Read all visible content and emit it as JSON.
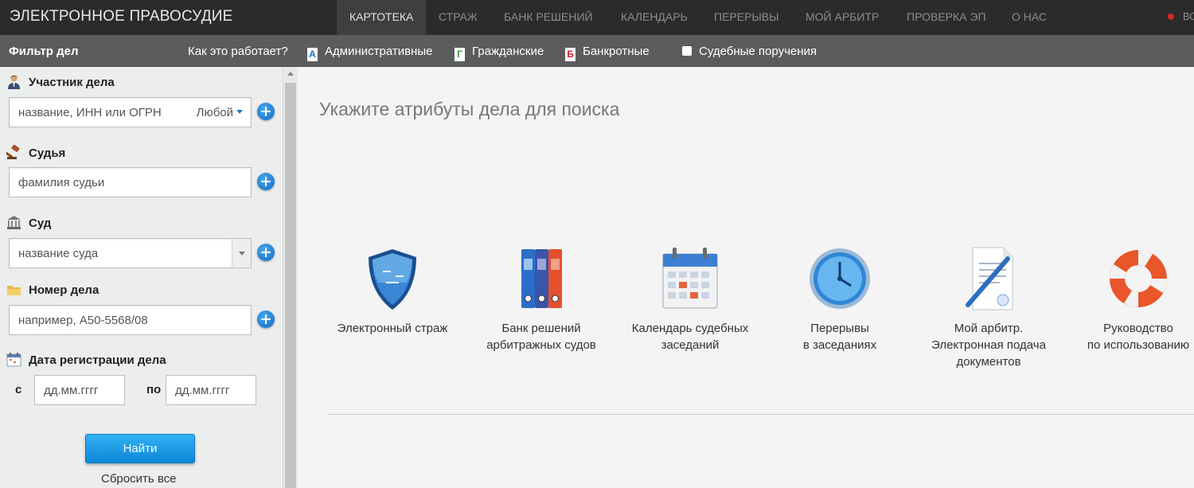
{
  "header": {
    "brand": "ЭЛЕКТРОННОЕ ПРАВОСУДИЕ",
    "nav": [
      {
        "label": "КАРТОТЕКА",
        "active": true
      },
      {
        "label": "СТРАЖ",
        "active": false
      },
      {
        "label": "БАНК РЕШЕНИЙ",
        "active": false
      },
      {
        "label": "КАЛЕНДАРЬ",
        "active": false
      },
      {
        "label": "ПЕРЕРЫВЫ",
        "active": false
      },
      {
        "label": "МОЙ АРБИТР",
        "active": false
      },
      {
        "label": "ПРОВЕРКА ЭП",
        "active": false
      },
      {
        "label": "О НАС",
        "active": false
      }
    ],
    "user_partial": "ВО"
  },
  "filter_bar": {
    "title": "Фильтр дел",
    "help_link": "Как это работает?",
    "categories": [
      {
        "badge": "А",
        "label": "Административные",
        "color": "#1a6fc4"
      },
      {
        "badge": "Г",
        "label": "Гражданские",
        "color": "#3d9b35"
      },
      {
        "badge": "Б",
        "label": "Банкротные",
        "color": "#c8272c"
      },
      {
        "badge": "",
        "label": "Судебные поручения",
        "color": "#ffffff"
      }
    ]
  },
  "sidebar": {
    "participant": {
      "label": "Участник дела",
      "placeholder": "название, ИНН или ОГРН",
      "type_value": "Любой",
      "icon": "person-icon"
    },
    "judge": {
      "label": "Судья",
      "placeholder": "фамилия судьи",
      "icon": "gavel-icon"
    },
    "court": {
      "label": "Суд",
      "placeholder": "название суда",
      "icon": "courthouse-icon"
    },
    "case_number": {
      "label": "Номер дела",
      "placeholder": "например, А50-5568/08",
      "icon": "folder-icon"
    },
    "date": {
      "label": "Дата регистрации дела",
      "from_label": "с",
      "to_label": "по",
      "from_placeholder": "дд.мм.гггг",
      "to_placeholder": "дд.мм.гггг",
      "icon": "calendar-icon"
    },
    "find_button": "Найти",
    "reset_link": "Сбросить все"
  },
  "main": {
    "title": "Укажите атрибуты дела для поиска",
    "tiles": [
      {
        "line1": "Электронный страж",
        "line2": "",
        "line3": "",
        "icon": "shield-icon"
      },
      {
        "line1": "Банк решений",
        "line2": "арбитражных судов",
        "line3": "",
        "icon": "binders-icon"
      },
      {
        "line1": "Календарь судебных",
        "line2": "заседаний",
        "line3": "",
        "icon": "calendar-icon"
      },
      {
        "line1": "Перерывы",
        "line2": "в заседаниях",
        "line3": "",
        "icon": "clock-icon"
      },
      {
        "line1": "Мой арбитр.",
        "line2": "Электронная подача",
        "line3": "документов",
        "icon": "document-pen-icon"
      },
      {
        "line1": "Руководство",
        "line2": "по использованию",
        "line3": "",
        "icon": "lifebuoy-icon"
      }
    ]
  }
}
